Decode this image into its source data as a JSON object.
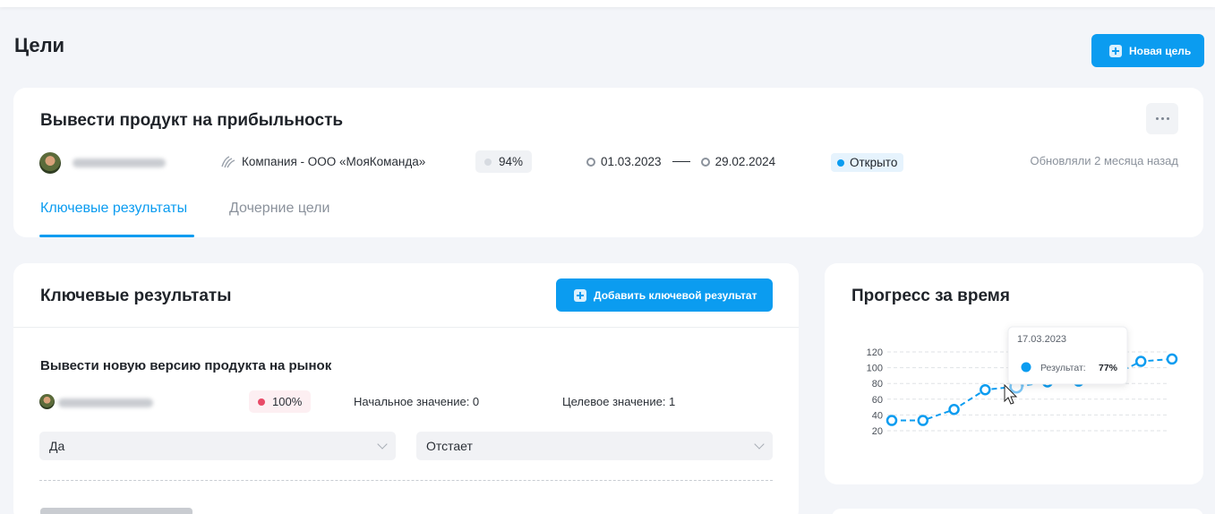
{
  "page": {
    "title": "Цели",
    "new_goal_label": "Новая цель"
  },
  "goal": {
    "title": "Вывести продукт на прибыльность",
    "company": "Компания - ООО «МояКоманда»",
    "progress": "94%",
    "start_date": "01.03.2023",
    "end_date": "29.02.2024",
    "status": "Открыто",
    "updated": "Обновляли 2 месяца назад",
    "tabs": [
      {
        "label": "Ключевые результаты",
        "active": true
      },
      {
        "label": "Дочерние цели",
        "active": false
      }
    ]
  },
  "key_results": {
    "title": "Ключевые результаты",
    "add_label": "Добавить ключевой результат",
    "items": [
      {
        "title": "Вывести новую версию продукта на рынок",
        "progress": "100%",
        "initial": "Начальное значение: 0",
        "target": "Целевое значение: 1",
        "value_select": "Да",
        "status_select": "Отстает"
      }
    ]
  },
  "chart": {
    "title": "Прогресс за время",
    "tooltip": {
      "date": "17.03.2023",
      "label": "Результат:",
      "value": "77%"
    }
  },
  "chart_data": {
    "type": "line",
    "series": [
      {
        "values": [
          33,
          33,
          47,
          72,
          76,
          82,
          83,
          88,
          108,
          111
        ]
      }
    ],
    "yticks": [
      20,
      40,
      60,
      80,
      100,
      120
    ],
    "ylim": [
      20,
      120
    ],
    "grid": true,
    "highlight_index": 4
  },
  "colors": {
    "accent": "#0b9cf0",
    "status_open": "#0b9cf0",
    "kr_progress_dot": "#e84a67",
    "goal_progress_dot": "#d7dbe1"
  }
}
